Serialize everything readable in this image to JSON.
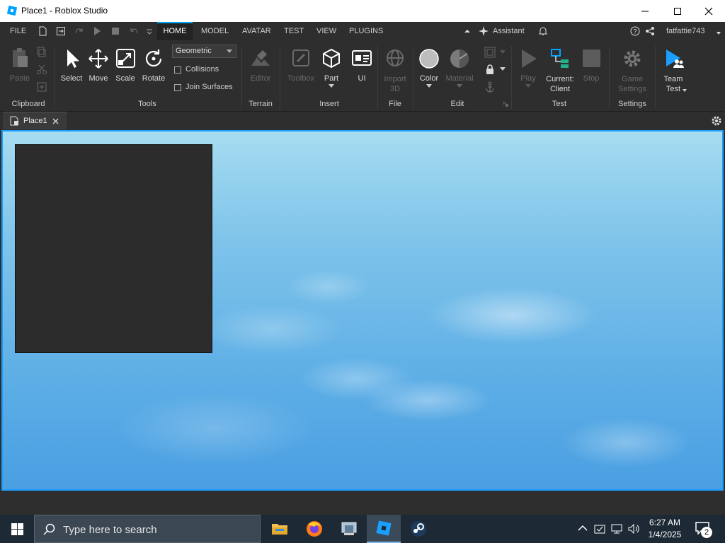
{
  "window": {
    "title": "Place1 - Roblox Studio"
  },
  "menubar": {
    "file": "FILE",
    "tabs": [
      "HOME",
      "MODEL",
      "AVATAR",
      "TEST",
      "VIEW",
      "PLUGINS"
    ],
    "assistant": "Assistant",
    "username": "fatfattie743"
  },
  "ribbon": {
    "clipboard": {
      "paste": "Paste",
      "group": "Clipboard"
    },
    "tools": {
      "select": "Select",
      "move": "Move",
      "scale": "Scale",
      "rotate": "Rotate",
      "group": "Tools",
      "mode_select": "Geometric",
      "collisions": "Collisions",
      "join_surfaces": "Join Surfaces"
    },
    "terrain": {
      "editor": "Editor",
      "group": "Terrain"
    },
    "insert": {
      "toolbox": "Toolbox",
      "part": "Part",
      "ui": "UI",
      "group": "Insert"
    },
    "file": {
      "import3d_line1": "Import",
      "import3d_line2": "3D",
      "group": "File"
    },
    "edit": {
      "color": "Color",
      "material": "Material",
      "group": "Edit"
    },
    "test": {
      "play": "Play",
      "current_line1": "Current:",
      "current_line2": "Client",
      "stop": "Stop",
      "group": "Test"
    },
    "settings": {
      "game_line1": "Game",
      "game_line2": "Settings",
      "group": "Settings"
    },
    "teamtest": {
      "line1": "Team",
      "line2": "Test"
    }
  },
  "doc_tab": {
    "label": "Place1"
  },
  "taskbar": {
    "search_placeholder": "Type here to search",
    "time": "6:27 AM",
    "date": "1/4/2025",
    "notification_count": "2"
  },
  "colors": {
    "accent": "#00a2ff",
    "ribbon_bg": "#2e2e2e",
    "taskbar_bg": "#1d2a35"
  }
}
